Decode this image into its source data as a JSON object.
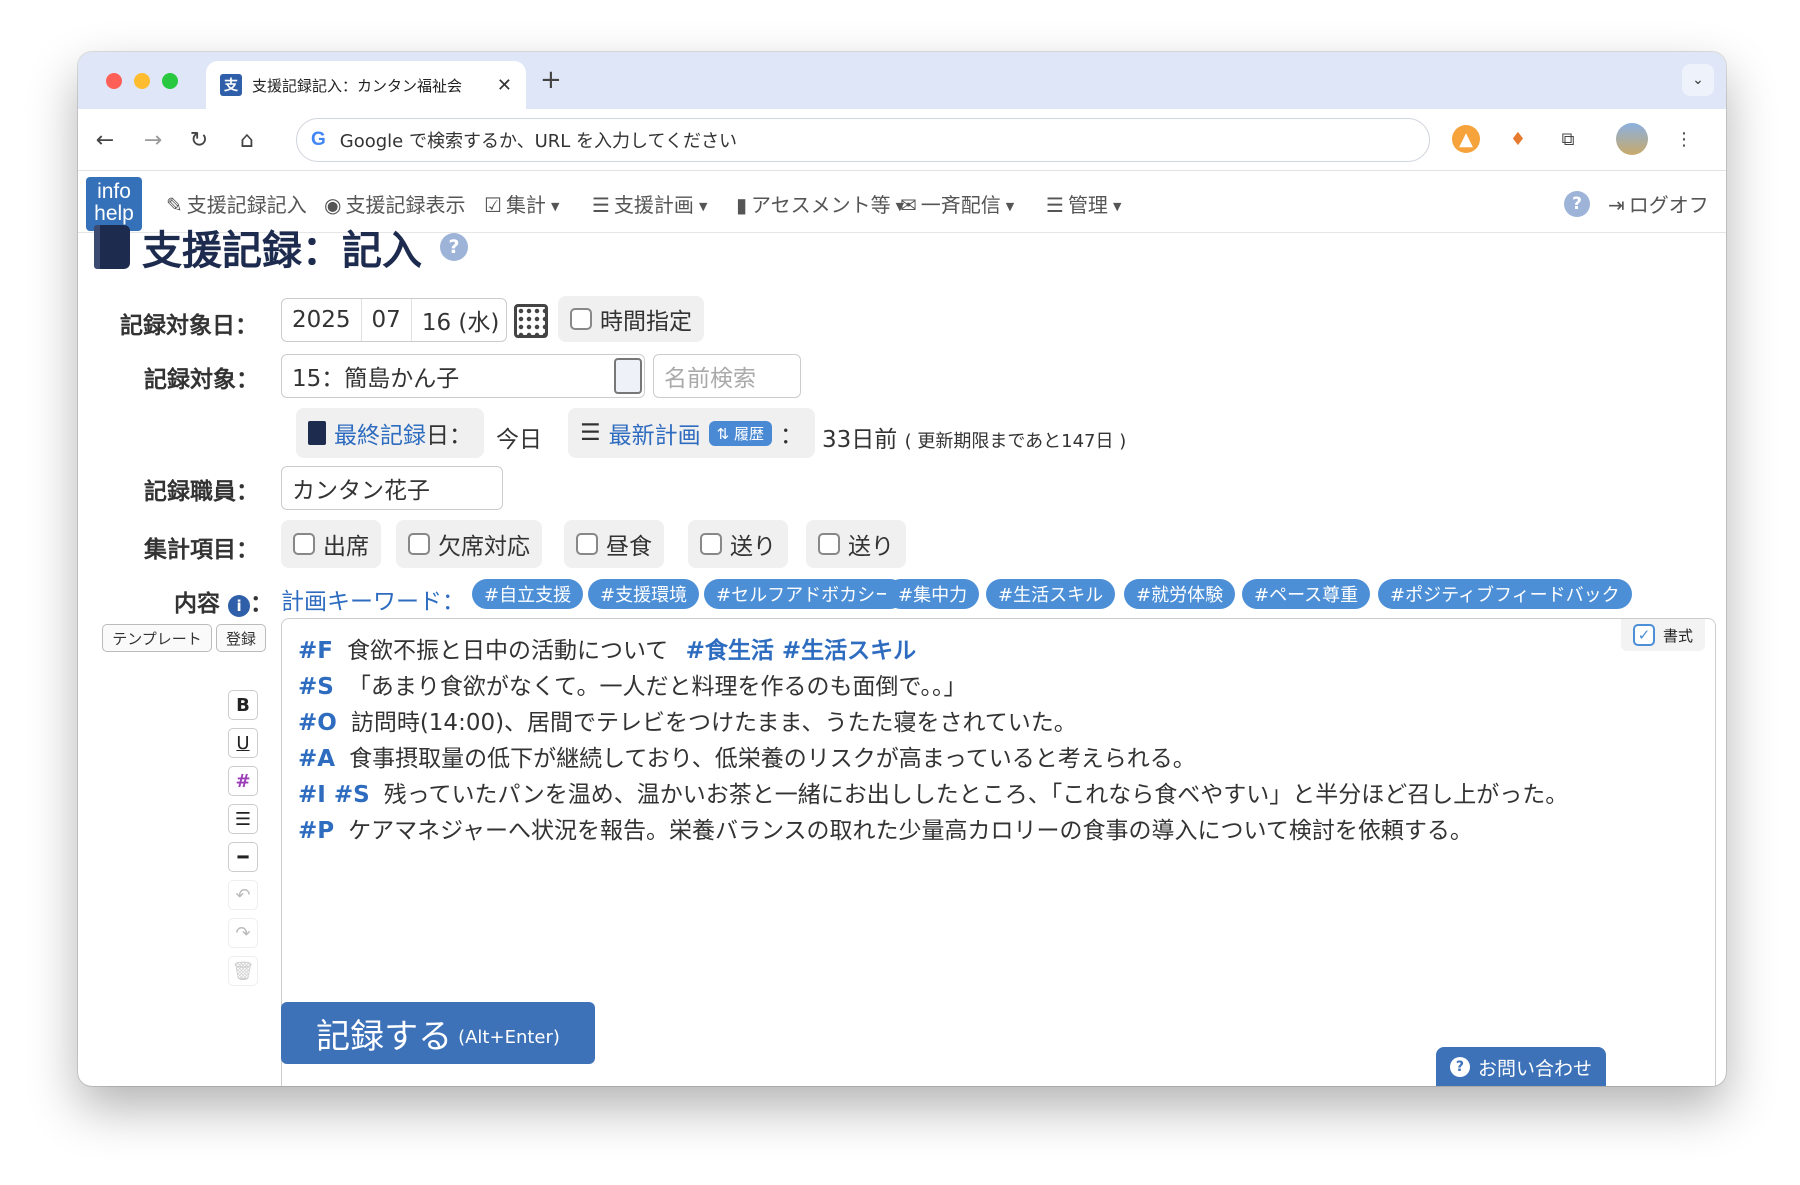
{
  "browser": {
    "tab_title": "支援記録記入：カンタン福祉会",
    "favicon_char": "支",
    "omnibox_placeholder": "Google で検索するか、URL を入力してください"
  },
  "nav": {
    "logo_top": "info",
    "logo_bottom": "help",
    "items": [
      {
        "label": "支援記録記入",
        "icon": "pencil-icon"
      },
      {
        "label": "支援記録表示",
        "icon": "eye-icon"
      },
      {
        "label": "集計",
        "icon": "checkbox-icon",
        "has_menu": true
      },
      {
        "label": "支援計画",
        "icon": "list-icon",
        "has_menu": true
      },
      {
        "label": "アセスメント等",
        "icon": "document-icon",
        "has_menu": true
      },
      {
        "label": "一斉配信",
        "icon": "envelope-icon",
        "has_menu": true
      },
      {
        "label": "管理",
        "icon": "list-icon",
        "has_menu": true
      }
    ],
    "logout": "ログオフ"
  },
  "page": {
    "title": "支援記録：記入",
    "date_label": "記録対象日：",
    "date": {
      "year": "2025",
      "month": "07",
      "day": "16 (水)"
    },
    "time_spec_label": "時間指定",
    "target_label": "記録対象：",
    "target_value": "15：簡島かん子",
    "name_search_placeholder": "名前検索",
    "last_record_link": "最終記録",
    "last_record_suffix": "日：",
    "last_record_value": "今日",
    "latest_plan_link": "最新計画",
    "history_badge": "履歴",
    "latest_plan_value": "33日前",
    "latest_plan_note": "( 更新期限まであと147日 )",
    "staff_label": "記録職員：",
    "staff_value": "カンタン花子",
    "tally_label": "集計項目：",
    "tally_items": [
      "出席",
      "欠席対応",
      "昼食",
      "送り",
      "送り"
    ],
    "content_label": "内容",
    "keyword_label": "計画キーワード：",
    "keywords": [
      "#自立支援",
      "#支援環境",
      "#セルフアドボカシー",
      "#集中力",
      "#生活スキル",
      "#就労体験",
      "#ペース尊重",
      "#ポジティブフィードバック"
    ],
    "template_btn": "テンプレート",
    "register_btn": "登録",
    "format_label": "書式",
    "lines": [
      {
        "tag": "#F",
        "text": "食欲不振と日中の活動について",
        "extra": "#食生活  #生活スキル"
      },
      {
        "tag": "#S",
        "text": "「あまり食欲がなくて。一人だと料理を作るのも面倒で。。」",
        "extra": ""
      },
      {
        "tag": "#O",
        "text": "訪問時(14:00)、居間でテレビをつけたまま、うたた寝をされていた。",
        "extra": ""
      },
      {
        "tag": "#A",
        "text": "食事摂取量の低下が継続しており、低栄養のリスクが高まっていると考えられる。",
        "extra": ""
      },
      {
        "tag": "#I  #S",
        "text": "残っていたパンを温め、温かいお茶と一緒にお出ししたところ、「これなら食べやすい」と半分ほど召し上がった。",
        "extra": ""
      },
      {
        "tag": "#P",
        "text": "ケアマネジャーへ状況を報告。栄養バランスの取れた少量高カロリーの食事の導入について検討を依頼する。",
        "extra": ""
      }
    ],
    "submit_main": "記録する",
    "submit_sub": "(Alt+Enter)",
    "contact_btn": "お問い合わせ"
  },
  "colors": {
    "accent": "#3d72b9",
    "keyword_bg": "#4c8fd6",
    "tab_strip": "#dfe6f7",
    "title": "#1d2b4f"
  }
}
